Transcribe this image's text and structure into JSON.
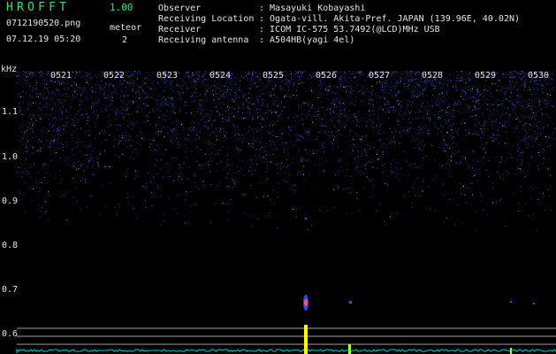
{
  "header": {
    "app_name": "HROFFT",
    "version": "1.00",
    "filename": "0712190520.png",
    "datetime": "07.12.19 05:20",
    "meteor_label": "meteor",
    "meteor_count": "2"
  },
  "info": [
    {
      "label": "Observer",
      "value": ": Masayuki Kobayashi"
    },
    {
      "label": "Receiving Location",
      "value": ": Ogata-vill. Akita-Pref. JAPAN (139.96E, 40.02N)"
    },
    {
      "label": "Receiver",
      "value": ": ICOM IC-575 53.7492(@LCD)MHz USB"
    },
    {
      "label": "Receiving antenna",
      "value": ": A504HB(yagi 4el)"
    }
  ],
  "axis": {
    "unit": "kHz",
    "y_ticks": [
      "1.1",
      "1.0",
      "0.9",
      "0.8",
      "0.7",
      "0.6"
    ],
    "x_ticks": [
      "0521",
      "0522",
      "0523",
      "0524",
      "0525",
      "0526",
      "0527",
      "0528",
      "0529",
      "0530"
    ]
  },
  "colors": {
    "background": "#000000",
    "app_title": "#35e26a",
    "text": "#e6e6e6",
    "noise": "#3a4cff",
    "meteor_echo": "#ff5a5a",
    "level_line": "#a0a0a0",
    "peak": "#ffff00",
    "baseline": "#00c8c8"
  }
}
